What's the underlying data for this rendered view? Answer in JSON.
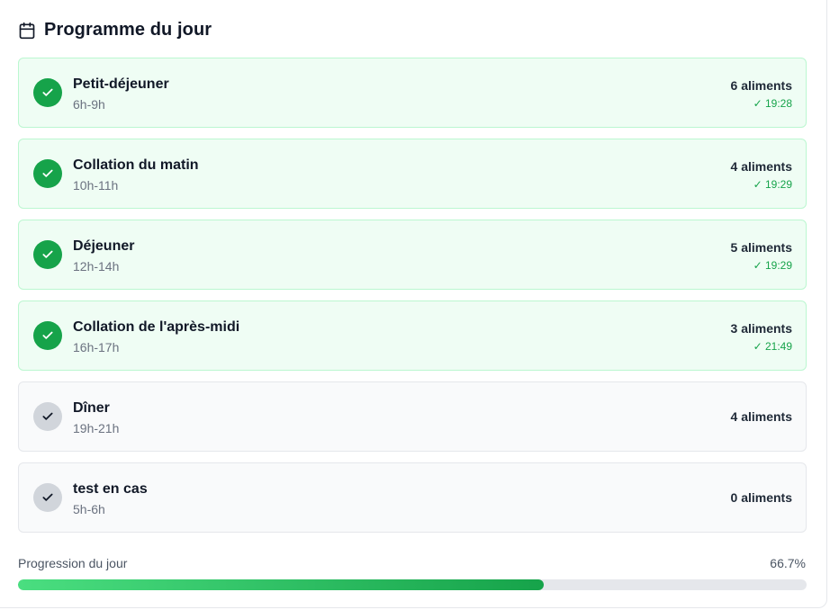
{
  "header": {
    "title": "Programme du jour",
    "icon": "calendar-icon"
  },
  "meals": [
    {
      "name": "Petit-déjeuner",
      "time": "6h-9h",
      "count": "6 aliments",
      "completed_at": "✓ 19:28",
      "status": "completed",
      "icon": "check-icon"
    },
    {
      "name": "Collation du matin",
      "time": "10h-11h",
      "count": "4 aliments",
      "completed_at": "✓ 19:29",
      "status": "completed",
      "icon": "check-icon"
    },
    {
      "name": "Déjeuner",
      "time": "12h-14h",
      "count": "5 aliments",
      "completed_at": "✓ 19:29",
      "status": "completed",
      "icon": "check-icon"
    },
    {
      "name": "Collation de l'après-midi",
      "time": "16h-17h",
      "count": "3 aliments",
      "completed_at": "✓ 21:49",
      "status": "completed",
      "icon": "check-icon"
    },
    {
      "name": "Dîner",
      "time": "19h-21h",
      "count": "4 aliments",
      "completed_at": "",
      "status": "pending",
      "icon": "check-icon"
    },
    {
      "name": "test en cas",
      "time": "5h-6h",
      "count": "0 aliments",
      "completed_at": "",
      "status": "pending",
      "icon": "check-icon"
    }
  ],
  "progress": {
    "label": "Progression du jour",
    "value_text": "66.7%",
    "fraction": 0.667
  },
  "colors": {
    "completed": "#16a34a",
    "completed_bg": "#effdf4",
    "completed_border": "#bbf7d0",
    "pending": "#d1d5db",
    "pending_bg": "#f9fafb",
    "progress_start": "#4ade80",
    "progress_end": "#16a34a",
    "track": "#e5e7eb"
  }
}
